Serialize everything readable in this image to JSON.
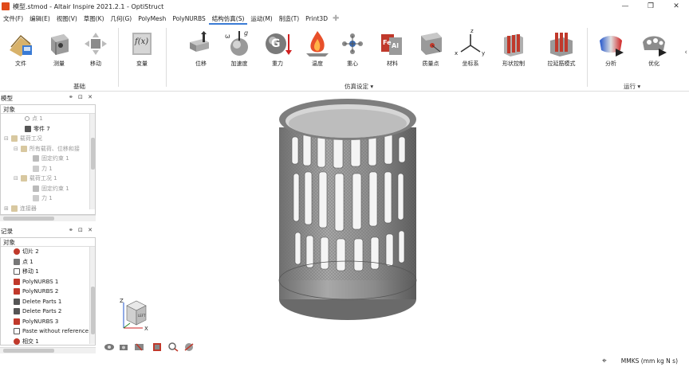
{
  "window": {
    "title": "模型.stmod - Altair Inspire 2021.2.1 - OptiStruct",
    "minimize_glyph": "—",
    "restore_glyph": "❐",
    "close_glyph": "✕"
  },
  "menu": {
    "items": [
      "文件(F)",
      "编辑(E)",
      "视图(V)",
      "草图(K)",
      "几何(G)",
      "PolyMesh",
      "PolyNURBS",
      "结构仿真(S)",
      "运动(M)",
      "制造(T)",
      "Print3D"
    ],
    "active_index": 7,
    "plus_glyph": "✚"
  },
  "ribbon": {
    "buttons": [
      {
        "label": "文件",
        "icon": "file-icon"
      },
      {
        "label": "测量",
        "icon": "measure-icon"
      },
      {
        "label": "移动",
        "icon": "move-icon"
      },
      {
        "label": "变量",
        "icon": "variable-icon"
      },
      {
        "label": "位移",
        "icon": "displacement-icon"
      },
      {
        "label": "加速度",
        "icon": "acceleration-icon"
      },
      {
        "label": "重力",
        "icon": "gravity-icon"
      },
      {
        "label": "温度",
        "icon": "temperature-icon"
      },
      {
        "label": "重心",
        "icon": "center-of-gravity-icon"
      },
      {
        "label": "材料",
        "icon": "material-icon"
      },
      {
        "label": "质量点",
        "icon": "mass-point-icon"
      },
      {
        "label": "坐标系",
        "icon": "coordinate-system-icon"
      },
      {
        "label": "形状控制",
        "icon": "shape-control-icon"
      },
      {
        "label": "拉延筋模式",
        "icon": "draw-bead-icon"
      },
      {
        "label": "分析",
        "icon": "analyze-icon"
      },
      {
        "label": "优化",
        "icon": "optimize-icon"
      }
    ],
    "groups": {
      "basic": "基础",
      "sim_setup": "仿真设定 ▾",
      "run": "运行 ▾"
    },
    "fx_text": "f(x)",
    "g_text": "G",
    "g_super": "g",
    "omega": "ω",
    "fe_text": "Fe",
    "al_text": "Al",
    "axis_z": "z",
    "axis_x": "x",
    "axis_y": "y",
    "collapse_arrow": "‹"
  },
  "model_panel": {
    "title": "模型",
    "header_icons": "⚭ ⊡ ✕",
    "column_header": "对象",
    "rows": [
      {
        "label": "点 1",
        "dim": true
      },
      {
        "label": "零件 7",
        "dim": false
      },
      {
        "label": "载荷工况",
        "dim": true
      },
      {
        "label": "所有载荷、位移和接",
        "dim": true
      },
      {
        "label": "固定约束 1",
        "dim": true
      },
      {
        "label": "力 1",
        "dim": true
      },
      {
        "label": "载荷工况 1",
        "dim": true
      },
      {
        "label": "固定约束 1",
        "dim": true
      },
      {
        "label": "力 1",
        "dim": true
      },
      {
        "label": "连接器",
        "dim": true
      }
    ],
    "expanders": [
      "⊟",
      "⊟",
      "⊟",
      "⊞"
    ]
  },
  "history_panel": {
    "title": "记录",
    "header_icons": "⚭ ⊡ ✕",
    "column_header": "对象",
    "rows": [
      "切片 2",
      "点 1",
      "移动 1",
      "PolyNURBS 1",
      "PolyNURBS 2",
      "Delete Parts 1",
      "Delete Parts 2",
      "PolyNURBS 3",
      "Paste without reference",
      "相交 1"
    ]
  },
  "viewcube": {
    "face_label": "LEFT",
    "axis_z": "Z",
    "axis_x": "X"
  },
  "status": {
    "units": "MMKS (mm kg N s)",
    "target_glyph": "⌖"
  },
  "colors": {
    "accent": "#3a7bd5",
    "model": "#8c8c8c"
  }
}
